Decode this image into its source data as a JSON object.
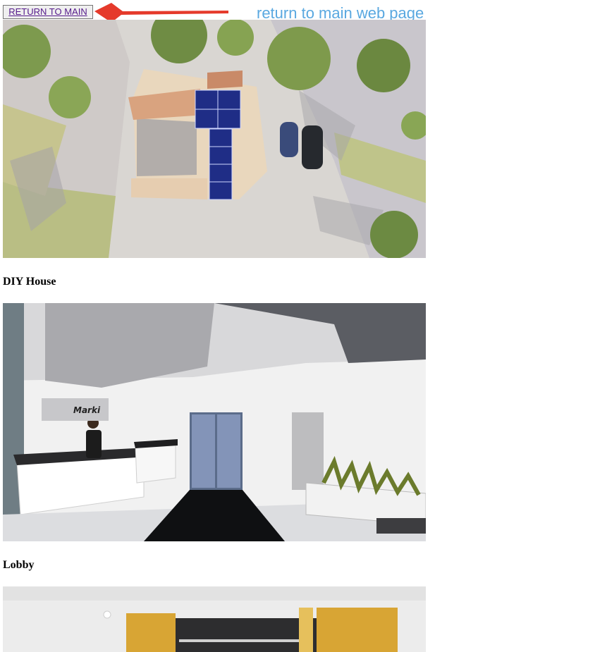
{
  "return_button": {
    "label": "RETURN TO MAIN"
  },
  "annotation": {
    "text": "return to main web page",
    "arrow_color": "#e53a2b",
    "text_color": "#5aa8e0"
  },
  "gallery": {
    "items": [
      {
        "caption": "DIY House"
      },
      {
        "caption": "Lobby"
      },
      {
        "caption": ""
      }
    ]
  },
  "lobby_sign": {
    "text": "Marki"
  }
}
